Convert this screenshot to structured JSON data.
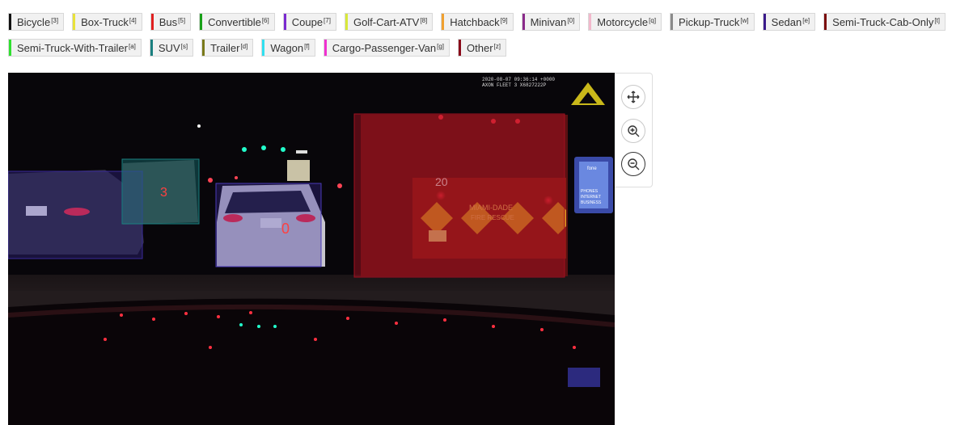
{
  "categories_row1": [
    {
      "name": "Bicycle",
      "key": "3",
      "color": "#111111"
    },
    {
      "name": "Box-Truck",
      "key": "4",
      "color": "#e8e23a"
    },
    {
      "name": "Bus",
      "key": "5",
      "color": "#e02020"
    },
    {
      "name": "Convertible",
      "key": "6",
      "color": "#18a018"
    },
    {
      "name": "Coupe",
      "key": "7",
      "color": "#7a2ad0"
    },
    {
      "name": "Golf-Cart-ATV",
      "key": "8",
      "color": "#d8e83a"
    },
    {
      "name": "Hatchback",
      "key": "9",
      "color": "#f0a030"
    },
    {
      "name": "Minivan",
      "key": "0",
      "color": "#8a2a8a"
    },
    {
      "name": "Motorcycle",
      "key": "q",
      "color": "#f2b8cc"
    },
    {
      "name": "Pickup-Truck",
      "key": "w",
      "color": "#8a8a8a"
    },
    {
      "name": "Sedan",
      "key": "e",
      "color": "#3a1a8a"
    },
    {
      "name": "Semi-Truck-Cab-Only",
      "key": "t",
      "color": "#7a0a0a"
    }
  ],
  "categories_row2": [
    {
      "name": "Semi-Truck-With-Trailer",
      "key": "a",
      "color": "#30e030"
    },
    {
      "name": "SUV",
      "key": "s",
      "color": "#1a8080"
    },
    {
      "name": "Trailer",
      "key": "d",
      "color": "#7a7a1a"
    },
    {
      "name": "Wagon",
      "key": "f",
      "color": "#30e0f0"
    },
    {
      "name": "Cargo-Passenger-Van",
      "key": "g",
      "color": "#f030d0"
    },
    {
      "name": "Other",
      "key": "z",
      "color": "#8a0a1a"
    }
  ],
  "image": {
    "timestamp": "2020-08-07 09:36:14 +0000",
    "camera_id": "AXON FLEET 3 X6827222P",
    "truck_lettering": "MIAMI-DADE",
    "truck_lettering2": "FIRE RESCUE",
    "truck_number": "20",
    "box_labels": {
      "sedan_left": "",
      "suv_center": "3",
      "sedan_center": "0",
      "truck_right": ""
    },
    "billboard_text": [
      "fone",
      "PHONES",
      "INTERNET",
      "BUSINESS"
    ]
  },
  "controls": {
    "pan": "move-icon",
    "zoom_in": "zoom-in-icon",
    "zoom_out": "zoom-out-icon"
  }
}
